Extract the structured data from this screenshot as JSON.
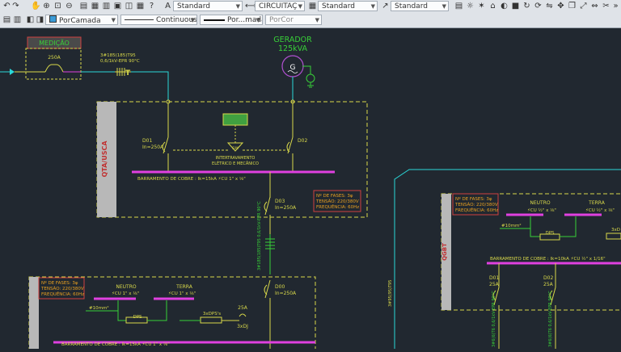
{
  "toolbar_top": {
    "style_dropdowns": [
      {
        "value": "Standard"
      },
      {
        "value": "CIRCUITAÇ"
      },
      {
        "value": "Standard"
      },
      {
        "value": "Standard"
      }
    ]
  },
  "toolbar_props": {
    "layer": "PorCamada",
    "linetype": "Continuous",
    "lineweight": "Por...mada",
    "plotstyle": "PorCor"
  },
  "drawing": {
    "meter_label": "MEDIÇÃO",
    "meter_breaker": "250A",
    "cable1": [
      "3#185(185)T95",
      "0,6/1kV-EPR 90°C"
    ],
    "generator_title": [
      "GERADOR",
      "125kVA"
    ],
    "generator_symbol": "G",
    "qta_label": "QTA/USCA",
    "d01": [
      "D01",
      "In=250A"
    ],
    "d02": "D02",
    "interlock": [
      "INTERTRAVAMENTO",
      "ELÉTRICO E MECÂNICO"
    ],
    "interlock_symbol": "E/M",
    "busbar1": "BARRAMENTO DE COBRE : Ik=15kA  ⚡CU 1\" x ⅛\"",
    "info1": [
      "Nº DE FASES: 3φ",
      "TENSÃO: 220/380V",
      "FREQUÊNCIA: 60Hz"
    ],
    "d03": [
      "D03",
      "In=250A"
    ],
    "cable2": "3#185(185)T95 0,6/1kV-EPR 90°C",
    "d00": [
      "D00",
      "In=250A"
    ],
    "bottom_panel": {
      "info": [
        "Nº DE FASES: 3φ",
        "TENSÃO: 220/380V",
        "FREQUÊNCIA: 60Hz"
      ],
      "neutro": "NEUTRO",
      "neutro_bar": "⚡CU 1\" x ⅛\"",
      "terra": "TERRA",
      "terra_bar": "⚡CU 1\" x ⅛\"",
      "ground": "#10mm²",
      "dps": "DPS",
      "dps3": "3xDPS's",
      "breaker": [
        "25A",
        "3xDJ"
      ],
      "busbar": "BARRAMENTO DE COBRE : Ik=15kA  ⚡CU 1\" x ⅛\""
    },
    "right_panel": {
      "side_label": "QGBT",
      "info": [
        "Nº DE FASES: 3φ",
        "TENSÃO: 220/380V",
        "FREQUÊNCIA: 60Hz"
      ],
      "neutro": "NEUTRO",
      "neutro_bar": "⚡CU ½\" x ⅛\"",
      "terra": "TERRA",
      "terra_bar": "⚡CU ½\" x ⅛\"",
      "ground": "#10mm²",
      "dps": "DPS",
      "dps3": "3xD",
      "busbar": "BARRAMENTO DE COBRE : Ik=10kA  ⚡CU ½\" x 1/16\"",
      "d01": [
        "D01",
        "25A"
      ],
      "d02": [
        "D02",
        "25A"
      ],
      "feeder_cable": "3#6(6)T6 0,6/1kV-EPR 90°C",
      "cable_v": "3#95(95)T95"
    }
  }
}
